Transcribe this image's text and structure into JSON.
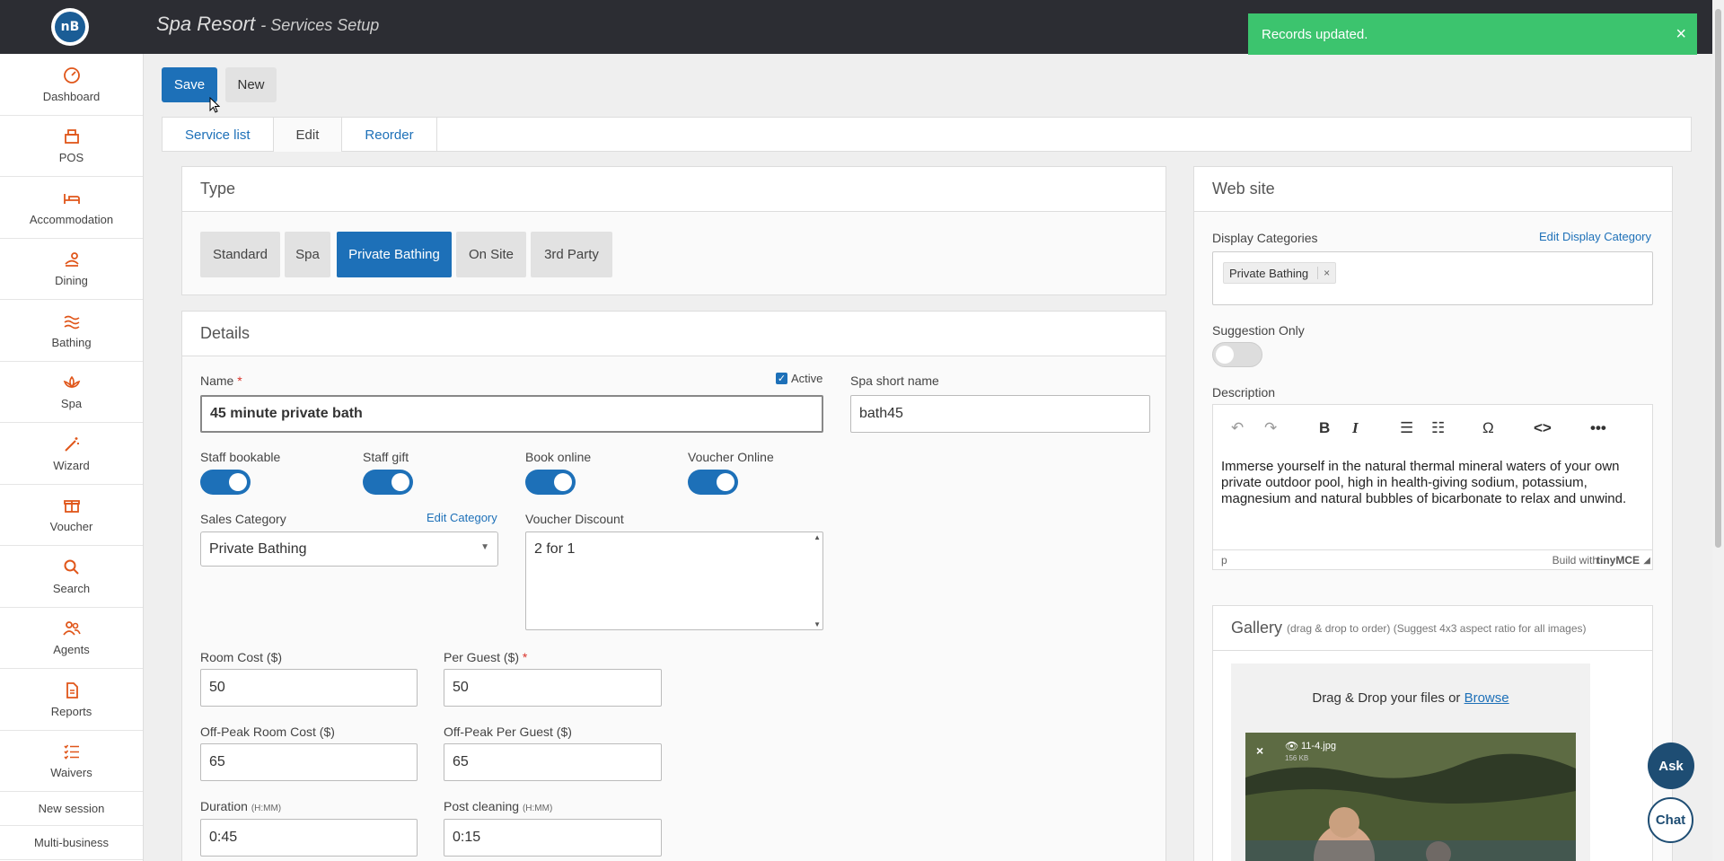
{
  "app": {
    "title": "Spa Resort",
    "subtitle": "Services Setup",
    "logo_text": "nB"
  },
  "sidebar": {
    "items": [
      {
        "label": "Dashboard",
        "icon": "dashboard-icon"
      },
      {
        "label": "POS",
        "icon": "pos-icon"
      },
      {
        "label": "Accommodation",
        "icon": "bed-icon"
      },
      {
        "label": "Dining",
        "icon": "dining-icon"
      },
      {
        "label": "Bathing",
        "icon": "water-icon"
      },
      {
        "label": "Spa",
        "icon": "lotus-icon"
      },
      {
        "label": "Wizard",
        "icon": "wand-icon"
      },
      {
        "label": "Voucher",
        "icon": "gift-icon"
      },
      {
        "label": "Search",
        "icon": "search-icon"
      },
      {
        "label": "Agents",
        "icon": "agents-icon"
      },
      {
        "label": "Reports",
        "icon": "report-icon"
      },
      {
        "label": "Waivers",
        "icon": "list-icon"
      }
    ],
    "new_session": "New session",
    "multi_business": "Multi-business"
  },
  "toolbar": {
    "save": "Save",
    "new": "New"
  },
  "toast": {
    "message": "Records updated.",
    "close": "×"
  },
  "tabs": [
    "Service list",
    "Edit",
    "Reorder"
  ],
  "type_panel": {
    "title": "Type",
    "options": [
      "Standard",
      "Spa",
      "Private Bathing",
      "On Site",
      "3rd Party"
    ],
    "selected": "Private Bathing"
  },
  "details": {
    "title": "Details",
    "name_label": "Name",
    "required_mark": "*",
    "name_value": "45 minute private bath",
    "active_label": "Active",
    "short_name_label": "Spa short name",
    "short_name_value": "bath45",
    "toggles": {
      "staff_bookable": "Staff bookable",
      "staff_gift": "Staff gift",
      "book_online": "Book online",
      "voucher_online": "Voucher Online"
    },
    "sales_category_label": "Sales Category",
    "edit_category": "Edit Category",
    "sales_category_value": "Private Bathing",
    "voucher_discount_label": "Voucher Discount",
    "voucher_discount_value": "2 for 1",
    "room_cost_label": "Room Cost ($)",
    "room_cost_value": "50",
    "per_guest_label": "Per Guest ($)",
    "per_guest_value": "50",
    "offpeak_room_label": "Off-Peak Room Cost ($)",
    "offpeak_room_value": "65",
    "offpeak_guest_label": "Off-Peak Per Guest ($)",
    "offpeak_guest_value": "65",
    "duration_label": "Duration",
    "duration_hint": "(H:MM)",
    "duration_value": "0:45",
    "post_cleaning_label": "Post cleaning",
    "post_cleaning_hint": "(H:MM)",
    "post_cleaning_value": "0:15"
  },
  "website": {
    "title": "Web site",
    "display_categories_label": "Display Categories",
    "edit_display_category": "Edit Display Category",
    "category_tag": "Private Bathing",
    "tag_remove": "×",
    "suggestion_only_label": "Suggestion Only",
    "description_label": "Description",
    "description_text": "Immerse yourself in the natural thermal mineral waters of your own private outdoor pool, high in health-giving sodium, potassium, magnesium and natural bubbles of bicarbonate to relax and unwind.",
    "editor_path": "p",
    "build_with": "Build with",
    "tinymce": "tinyMCE",
    "gallery_title": "Gallery",
    "gallery_hint": "(drag & drop to order) (Suggest 4x3 aspect ratio for all images)",
    "drop_text": "Drag & Drop your files or",
    "browse": "Browse",
    "file_name": "11-4.jpg",
    "file_size": "156 KB"
  },
  "fabs": {
    "ask": "Ask",
    "chat": "Chat"
  },
  "colors": {
    "primary": "#1d70b8",
    "accent": "#e0561a",
    "success": "#3cc46e",
    "topbar": "#2c2d33"
  }
}
